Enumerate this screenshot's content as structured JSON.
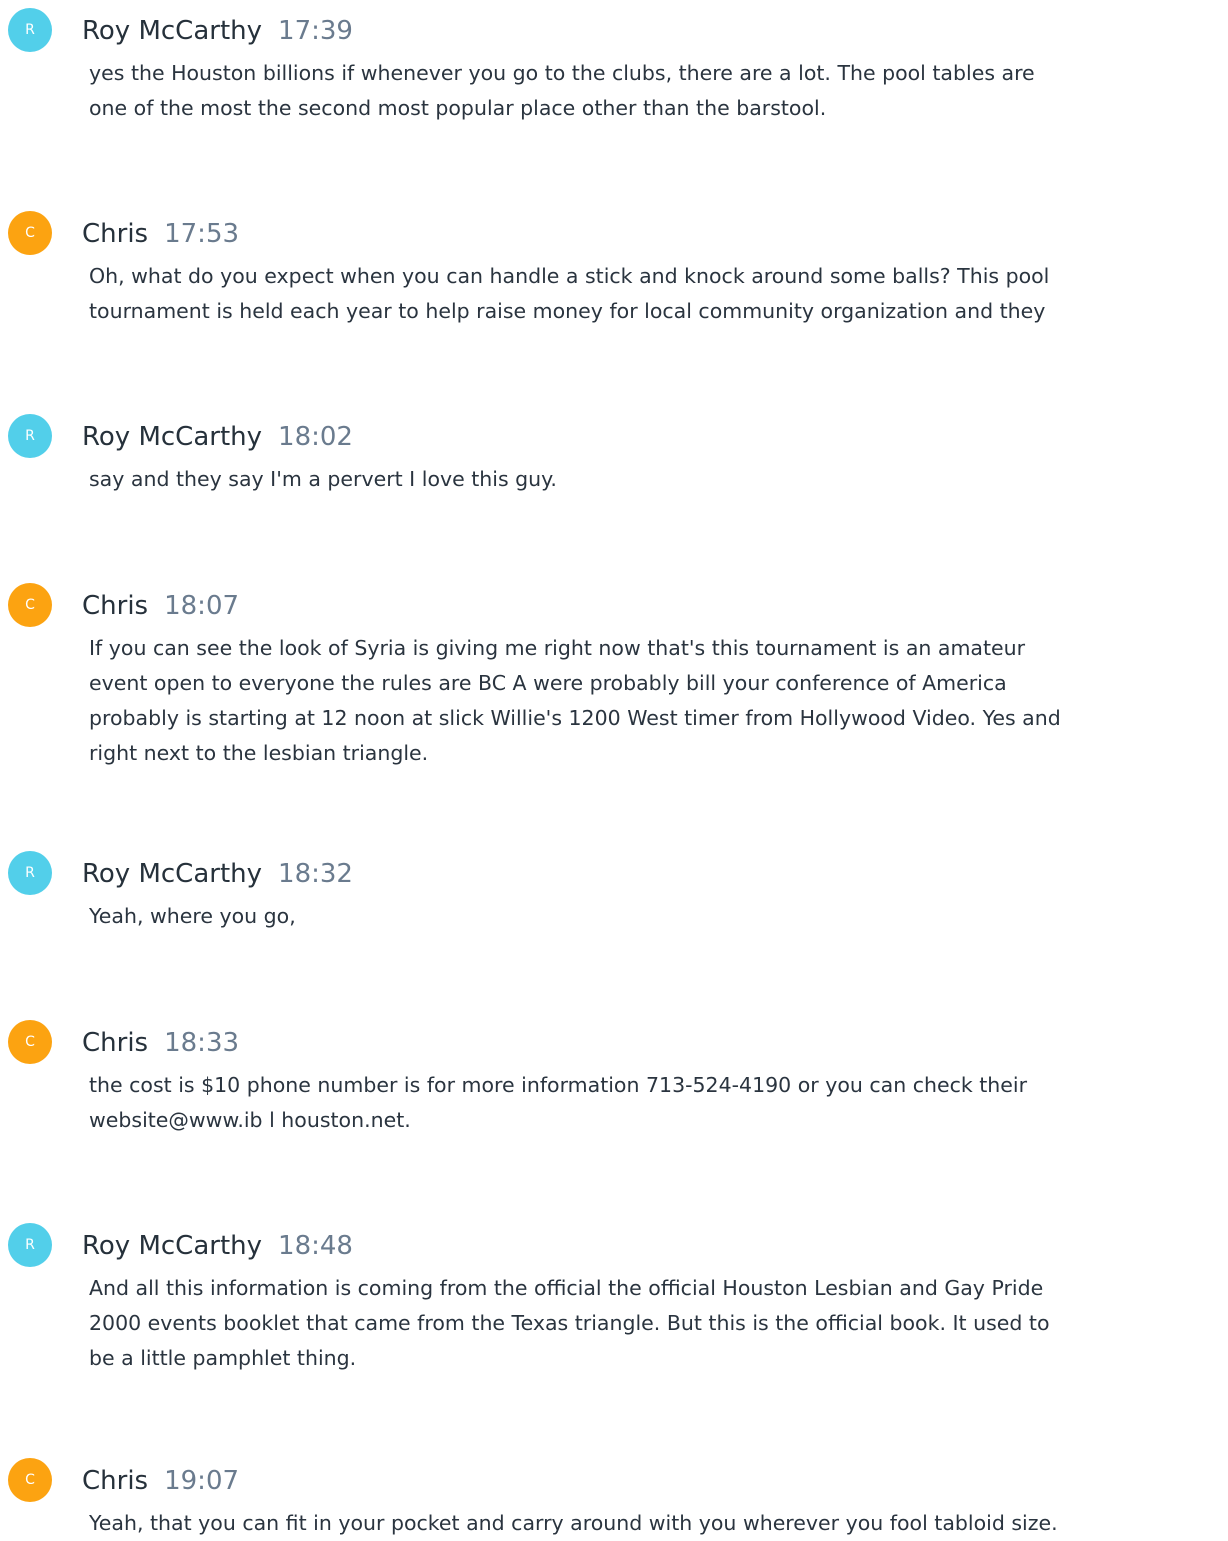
{
  "transcript": {
    "entries": [
      {
        "avatar_letter": "R",
        "speaker": "Roy McCarthy",
        "time": "17:39",
        "lines": [
          "yes the Houston billions if whenever you go to the clubs, there are a lot. The pool tables are",
          "one of the most the second most popular place other than the barstool."
        ],
        "avatar_color": "#52cfea"
      },
      {
        "avatar_letter": "C",
        "speaker": "Chris",
        "time": "17:53",
        "lines": [
          "Oh, what do you expect when you can handle a stick and knock around some balls? This pool",
          "tournament is held each year to help raise money for local community organization and they"
        ],
        "avatar_color": "#fca311"
      },
      {
        "avatar_letter": "R",
        "speaker": "Roy McCarthy",
        "time": "18:02",
        "lines": [
          "say and they say I'm a pervert I love this guy."
        ],
        "avatar_color": "#52cfea"
      },
      {
        "avatar_letter": "C",
        "speaker": "Chris",
        "time": "18:07",
        "lines": [
          "If you can see the look of Syria is giving me right now that's this tournament is an amateur",
          "event open to everyone the rules are BC A were probably bill your conference of America",
          "probably is starting at 12 noon at slick Willie's 1200 West timer from Hollywood Video. Yes and",
          "right next to the lesbian triangle."
        ],
        "avatar_color": "#fca311"
      },
      {
        "avatar_letter": "R",
        "speaker": "Roy McCarthy",
        "time": "18:32",
        "lines": [
          "Yeah, where you go,"
        ],
        "avatar_color": "#52cfea"
      },
      {
        "avatar_letter": "C",
        "speaker": "Chris",
        "time": "18:33",
        "lines": [
          "the cost is $10 phone number is for more information 713-524-4190 or you can check their",
          "website@www.ib l houston.net."
        ],
        "avatar_color": "#fca311"
      },
      {
        "avatar_letter": "R",
        "speaker": "Roy McCarthy",
        "time": "18:48",
        "lines": [
          "And all this information is coming from the official the official Houston Lesbian and Gay Pride",
          "2000 events booklet that came from the Texas triangle. But this is the official book. It used to",
          "be a little pamphlet thing."
        ],
        "avatar_color": "#52cfea"
      },
      {
        "avatar_letter": "C",
        "speaker": "Chris",
        "time": "19:07",
        "lines": [
          "Yeah, that you can fit in your pocket and carry around with you wherever you fool tabloid size."
        ],
        "avatar_color": "#fca311"
      }
    ]
  }
}
